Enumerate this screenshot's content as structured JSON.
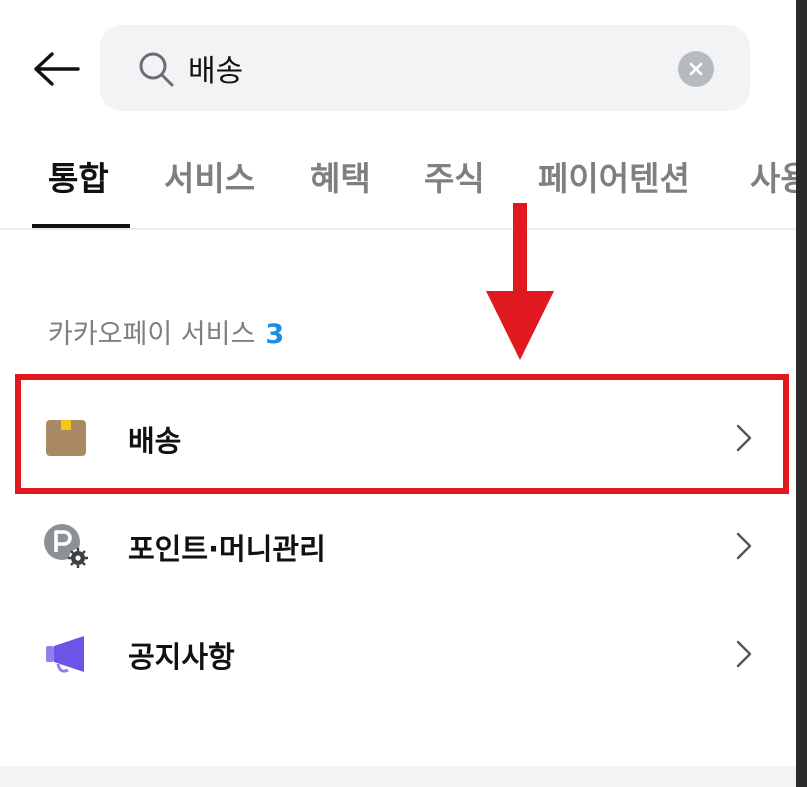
{
  "search": {
    "value": "배송",
    "back_icon": "arrow-left-icon",
    "search_icon": "magnifier-icon",
    "clear_icon": "x-circle-icon"
  },
  "tabs": [
    {
      "label": "통합",
      "active": true
    },
    {
      "label": "서비스",
      "active": false
    },
    {
      "label": "혜택",
      "active": false
    },
    {
      "label": "주식",
      "active": false
    },
    {
      "label": "페이어텐션",
      "active": false
    },
    {
      "label": "사용",
      "active": false
    }
  ],
  "section": {
    "title": "카카오페이 서비스",
    "count": "3"
  },
  "services": [
    {
      "label": "배송",
      "icon": "package-box-icon"
    },
    {
      "label": "포인트·머니관리",
      "icon": "point-settings-icon"
    },
    {
      "label": "공지사항",
      "icon": "megaphone-icon"
    }
  ],
  "colors": {
    "highlight": "#e0181f",
    "count_accent": "#1a8ee6",
    "search_bg": "#f2f3f5",
    "package": "#a98963",
    "package_tape": "#f5c518",
    "megaphone": "#6a55e6"
  }
}
